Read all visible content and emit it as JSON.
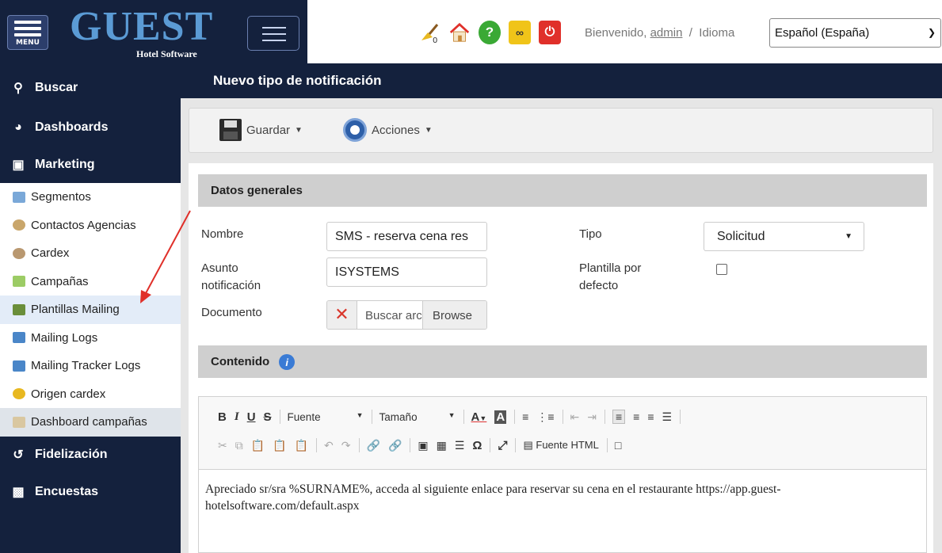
{
  "header": {
    "menu_label": "MENU",
    "logo_title": "GUEST",
    "logo_subtitle": "Hotel Software",
    "welcome_text": "Bienvenido,",
    "user_name": "admin",
    "separator": "/",
    "language_label": "Idioma",
    "language_value": "Español (España)"
  },
  "sidebar": {
    "main_items": [
      {
        "label": "Buscar",
        "icon": "search-icon"
      },
      {
        "label": "Dashboards",
        "icon": "pie-chart-icon"
      },
      {
        "label": "Marketing",
        "icon": "marketing-icon"
      },
      {
        "label": "Fidelización",
        "icon": "history-icon"
      },
      {
        "label": "Encuestas",
        "icon": "bar-chart-icon"
      }
    ],
    "sub_items": [
      {
        "label": "Segmentos",
        "icon": "segments-icon"
      },
      {
        "label": "Contactos Agencias",
        "icon": "contacts-icon"
      },
      {
        "label": "Cardex",
        "icon": "cardex-icon"
      },
      {
        "label": "Campañas",
        "icon": "campaigns-icon"
      },
      {
        "label": "Plantillas Mailing",
        "icon": "mail-template-icon"
      },
      {
        "label": "Mailing Logs",
        "icon": "logs-icon"
      },
      {
        "label": "Mailing Tracker Logs",
        "icon": "tracker-logs-icon"
      },
      {
        "label": "Origen cardex",
        "icon": "origin-icon"
      },
      {
        "label": "Dashboard campañas",
        "icon": "dashboard-icon"
      }
    ]
  },
  "page": {
    "title": "Nuevo tipo de notificación"
  },
  "toolbar": {
    "save_label": "Guardar",
    "actions_label": "Acciones"
  },
  "general": {
    "section_title": "Datos generales",
    "name_label": "Nombre",
    "name_value": "SMS - reserva cena res",
    "subject_label_1": "Asunto",
    "subject_label_2": "notificación",
    "subject_value": "ISYSTEMS",
    "document_label": "Documento",
    "document_placeholder": "Buscar archivo",
    "browse_label": "Browse",
    "type_label": "Tipo",
    "type_value": "Solicitud",
    "default_template_label_1": "Plantilla por",
    "default_template_label_2": "defecto"
  },
  "content": {
    "section_title": "Contenido",
    "font_combo": "Fuente",
    "size_combo": "Tamaño",
    "html_source": "Fuente HTML",
    "body_text": "Apreciado sr/sra %SURNAME%, acceda al siguiente enlace para reservar su cena en el restaurante https://app.guest-hotelsoftware.com/default.aspx"
  },
  "colors": {
    "navy": "#14213d",
    "accent_arrow": "#e0302a"
  }
}
